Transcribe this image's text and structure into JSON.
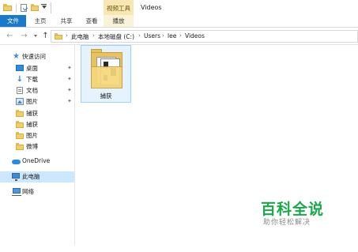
{
  "window": {
    "title": "Videos"
  },
  "ribbon": {
    "contextual_group": "视频工具",
    "tabs": [
      {
        "label": "文件"
      },
      {
        "label": "主页"
      },
      {
        "label": "共享"
      },
      {
        "label": "查看"
      },
      {
        "label": "播放"
      }
    ]
  },
  "address": {
    "crumbs": [
      "此电脑",
      "本地磁盘 (C:)",
      "Users",
      "lee",
      "Videos"
    ]
  },
  "nav_pane": {
    "quick_access": {
      "label": "快速访问",
      "items": [
        {
          "label": "桌面",
          "icon": "desktop-icon",
          "pinned": true
        },
        {
          "label": "下载",
          "icon": "download-icon",
          "pinned": true
        },
        {
          "label": "文档",
          "icon": "documents-icon",
          "pinned": true
        },
        {
          "label": "图片",
          "icon": "pictures-icon",
          "pinned": true
        },
        {
          "label": "捕获",
          "icon": "folder-icon",
          "pinned": false
        },
        {
          "label": "捕获",
          "icon": "folder-icon",
          "pinned": false
        },
        {
          "label": "图片",
          "icon": "folder-icon",
          "pinned": false
        },
        {
          "label": "微博",
          "icon": "folder-icon",
          "pinned": false
        }
      ]
    },
    "onedrive": {
      "label": "OneDrive"
    },
    "this_pc": {
      "label": "此电脑"
    },
    "network": {
      "label": "网络"
    }
  },
  "content": {
    "items": [
      {
        "label": "捕获",
        "icon": "folder-icon"
      }
    ]
  },
  "watermark": {
    "title": "百科全说",
    "subtitle": "助你轻松解决"
  }
}
